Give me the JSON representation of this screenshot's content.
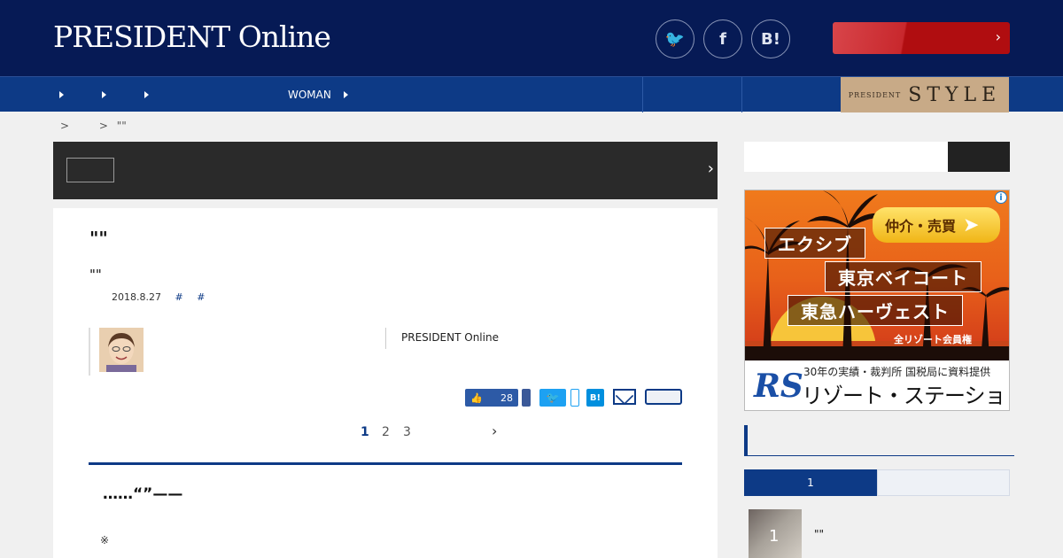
{
  "header": {
    "logo": "PRESIDENT Online",
    "social": {
      "twitter": "🐦",
      "facebook": "f",
      "hatena": "B!"
    },
    "promo_chevron": "›"
  },
  "nav": {
    "items": [
      "",
      "",
      "",
      "",
      "",
      "WOMAN",
      ""
    ],
    "style_small": "PRESIDENT",
    "style_big": "STYLE"
  },
  "breadcrumb": {
    "sep1": ">",
    "sep2": ">",
    "current": "\"\""
  },
  "banner": {
    "chevron": "›"
  },
  "article": {
    "title": "\"\"",
    "subtitle": "\"\"",
    "date": "2018.8.27",
    "hashtags": [
      "#",
      "#"
    ],
    "author_name": "PRESIDENT Online",
    "like_count": "28",
    "hatena_label": "B!",
    "twitter_glyph": "🐦",
    "pages": [
      "1",
      "2",
      "3"
    ],
    "pager_next": "›",
    "section_heading": "……“”——",
    "note": "※"
  },
  "sidebar": {
    "ad": {
      "pill": "仲介・売買",
      "ribbons": [
        "エクシブ",
        "東京ベイコート",
        "東急ハーヴェスト"
      ],
      "caption": "全リゾート会員権",
      "line1": "30年の実績・裁判所 国税局に資料提供",
      "line2": "リゾート・ステーション",
      "logo": "RS",
      "info": "i"
    },
    "tab_active": "1",
    "ranking": [
      {
        "num": "1",
        "title": "\"\""
      }
    ]
  }
}
